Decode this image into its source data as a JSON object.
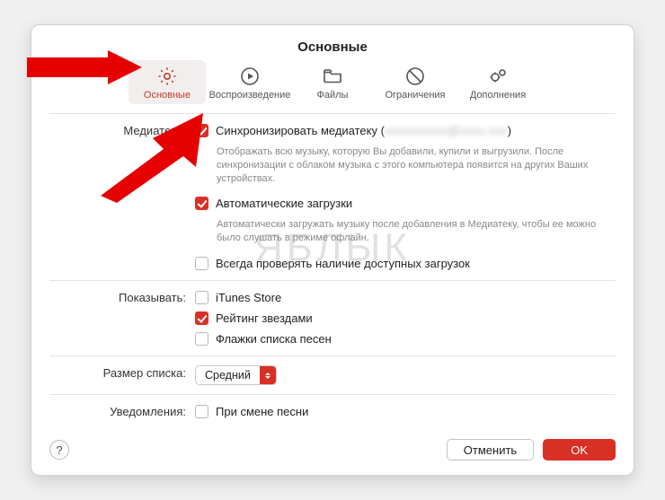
{
  "title": "Основные",
  "tabs": [
    {
      "label": "Основные"
    },
    {
      "label": "Воспроизведение"
    },
    {
      "label": "Файлы"
    },
    {
      "label": "Ограничения"
    },
    {
      "label": "Дополнения"
    }
  ],
  "accent": "#d93025",
  "library": {
    "section_label": "Медиатека:",
    "sync_label_prefix": "Синхронизировать медиатеку (",
    "sync_account_obscured": "xxxxxxxxxx@xxxx.xxx",
    "sync_label_suffix": ")",
    "sync_desc": "Отображать всю музыку, которую Вы добавили, купили и выгрузили. После синхронизации с облаком музыка с этого компьютера появится на других Ваших устройствах.",
    "auto_label": "Автоматические загрузки",
    "auto_desc": "Автоматически загружать музыку после добавления в Медиатеку, чтобы ее можно было слушать в режиме офлайн.",
    "always_check_label": "Всегда проверять наличие доступных загрузок"
  },
  "show": {
    "section_label": "Показывать:",
    "itunes_label": "iTunes Store",
    "stars_label": "Рейтинг звездами",
    "flags_label": "Флажки списка песен"
  },
  "list_size": {
    "section_label": "Размер списка:",
    "value": "Средний"
  },
  "notifications": {
    "section_label": "Уведомления:",
    "on_song_change_label": "При смене песни"
  },
  "buttons": {
    "help": "?",
    "cancel": "Отменить",
    "ok": "OK"
  },
  "watermark": "ЯБЛЫК"
}
